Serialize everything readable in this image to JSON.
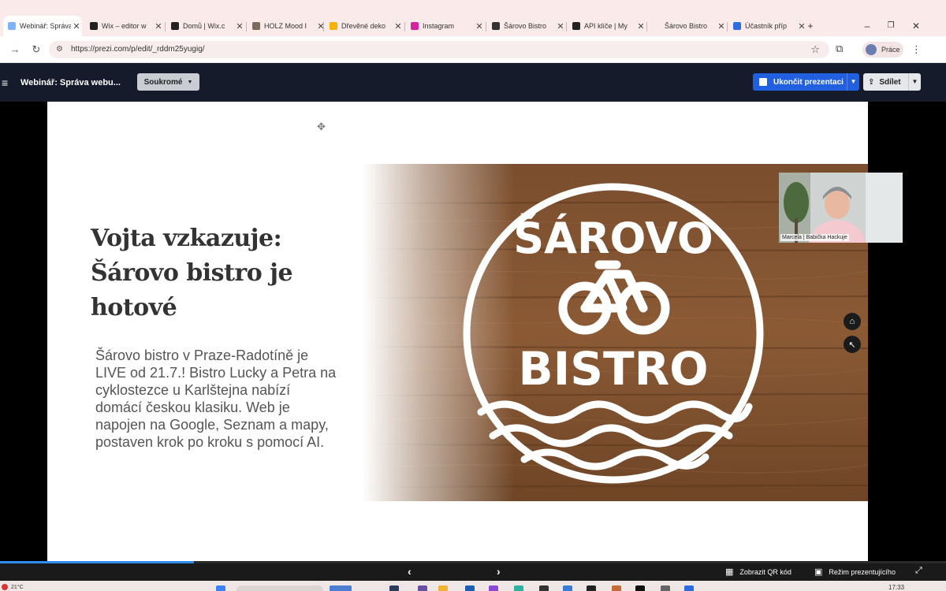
{
  "browser": {
    "tabs": [
      {
        "title": "Webinář: Správa",
        "icon": "prezi-icon",
        "color": "#7fb2ff",
        "active": true
      },
      {
        "title": "Wix – editor w",
        "icon": "wix-icon",
        "color": "#222222",
        "active": false
      },
      {
        "title": "Domů | Wix.c",
        "icon": "wix-icon",
        "color": "#222222",
        "active": false
      },
      {
        "title": "HOLZ Mood I",
        "icon": "holz-icon",
        "color": "#7a6b5a",
        "active": false
      },
      {
        "title": "Dřevěné deko",
        "icon": "google-icon",
        "color": "#f4b400",
        "active": false
      },
      {
        "title": "Instagram",
        "icon": "instagram-icon",
        "color": "#d6249f",
        "active": false
      },
      {
        "title": "Šárovo Bistro",
        "icon": "site-icon",
        "color": "#333333",
        "active": false
      },
      {
        "title": "API klíče | My",
        "icon": "wix-icon",
        "color": "#222222",
        "active": false
      },
      {
        "title": "Šárovo Bistro",
        "icon": "blank-icon",
        "color": "#fbeaea",
        "active": false
      },
      {
        "title": "Účastník příp",
        "icon": "meeting-icon",
        "color": "#2d6cdf",
        "active": false
      }
    ],
    "new_tab": "+",
    "minimize": "–",
    "restore": "❐",
    "close": "✕",
    "tab_close": "✕",
    "url": "https://prezi.com/p/edit/_rddm25yugig/",
    "profile_label": "Práce"
  },
  "prezi": {
    "title": "Webinář: Správa webu...",
    "privacy_label": "Soukromé",
    "end_label": "Ukončit prezentaci",
    "share_label": "Sdílet",
    "prev_label": "‹",
    "next_label": "›",
    "qr_label": "Zobrazit QR kód",
    "presenter_label": "Režim prezentujícího",
    "progress": 0.205
  },
  "slide": {
    "title": "Vojta vzkazuje: Šárovo bistro je hotové",
    "body": "Šárovo bistro v Praze-Radotíně je LIVE od 21.7.! Bistro Lucky a Petra na cyklostezce u Karlštejna nabízí domácí českou klasiku. Web je napojen na Google, Seznam a mapy, postaven krok po kroku s pomocí AI.",
    "logo_top": "ŠÁROVO",
    "logo_bottom": "BISTRO"
  },
  "webcam": {
    "name": "Marcela | Babička Hackuje"
  },
  "taskbar": {
    "weather": "21°C",
    "time": "17:33"
  }
}
